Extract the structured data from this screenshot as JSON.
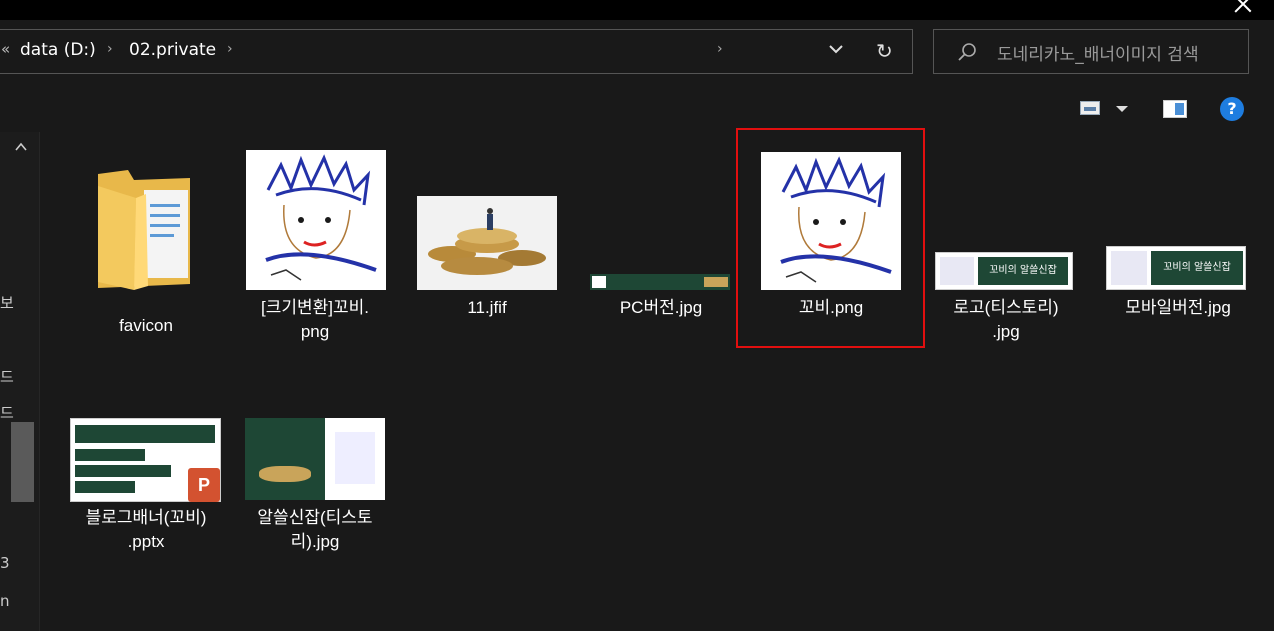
{
  "address": {
    "crumbs": [
      "data (D:)",
      "02.private"
    ]
  },
  "search": {
    "placeholder": "도네리카노_배너이미지 검색"
  },
  "toolbar": {
    "help_glyph": "?"
  },
  "nav_fragments": [
    "보",
    "드",
    "드",
    "3",
    "n"
  ],
  "files": [
    {
      "name": "favicon",
      "type": "folder"
    },
    {
      "name": "[크기변환]꼬비.png",
      "type": "image"
    },
    {
      "name": "11.jfif",
      "type": "image"
    },
    {
      "name": "PC버전.jpg",
      "type": "image"
    },
    {
      "name": "꼬비.png",
      "type": "image",
      "highlighted": true
    },
    {
      "name": "로고(티스토리).jpg",
      "type": "image"
    },
    {
      "name": "모바일버전.jpg",
      "type": "image"
    },
    {
      "name": "블로그배너(꼬비).pptx",
      "type": "pptx"
    },
    {
      "name": "알쓸신잡(티스토리).jpg",
      "type": "image"
    }
  ],
  "labels": {
    "f0_l1": "favicon",
    "f1_l1": "[크기변환]꼬비.",
    "f1_l2": "png",
    "f2_l1": "11.jfif",
    "f3_l1": "PC버전.jpg",
    "f4_l1": "꼬비.png",
    "f5_l1": "로고(티스토리)",
    "f5_l2": ".jpg",
    "f6_l1": "모바일버전.jpg",
    "f7_l1": "블로그배너(꼬비)",
    "f7_l2": ".pptx",
    "f8_l1": "알쓸신잡(티스토",
    "f8_l2": "리).jpg"
  },
  "banner_text": {
    "small": "꼬비의 알쓸신잡"
  },
  "colors": {
    "highlight": "#e10f0f",
    "folder": "#f3c95e",
    "banner_green": "#1e4735",
    "ppt": "#d35230",
    "help_blue": "#1e7de0"
  },
  "icons": [
    "search-icon",
    "refresh-icon",
    "chevron-down-icon",
    "view-icon",
    "preview-pane-icon",
    "help-icon",
    "close-icon",
    "folder-icon",
    "powerpoint-icon"
  ]
}
